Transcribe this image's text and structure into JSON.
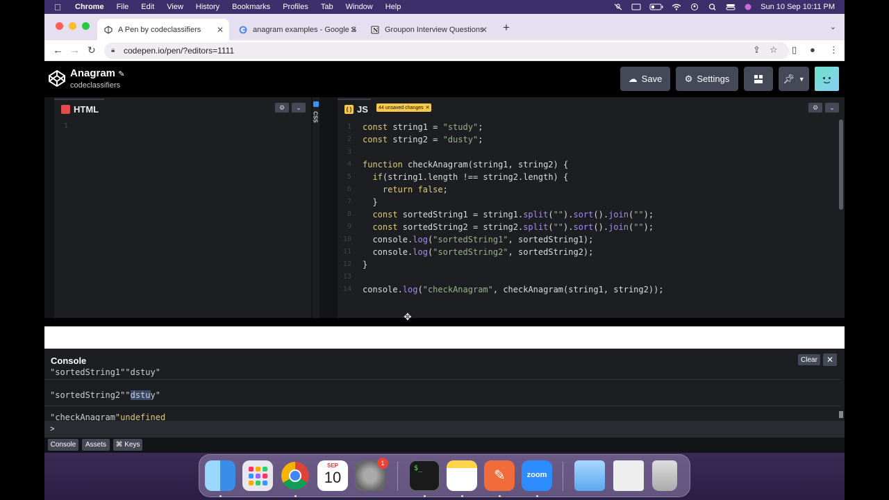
{
  "menubar": {
    "app": "Chrome",
    "items": [
      "File",
      "Edit",
      "View",
      "History",
      "Bookmarks",
      "Profiles",
      "Tab",
      "Window",
      "Help"
    ],
    "clock": "Sun 10 Sep  10:11 PM"
  },
  "browser": {
    "tabs": [
      {
        "title": "A Pen by codeclassifiers",
        "icon": "codepen-icon",
        "active": true
      },
      {
        "title": "anagram examples - Google S",
        "icon": "google-icon",
        "active": false
      },
      {
        "title": "Groupon Interview Questions",
        "icon": "notion-icon",
        "active": false
      }
    ],
    "url": "codepen.io/pen/?editors=1111"
  },
  "pen": {
    "title": "Anagram",
    "user": "codeclassifiers",
    "save_label": "Save",
    "settings_label": "Settings"
  },
  "html_pane": {
    "label": "HTML",
    "line_numbers": [
      "1"
    ]
  },
  "css_pane": {
    "label": "CSS"
  },
  "js_pane": {
    "label": "JS",
    "unsaved_badge": "44 unsaved changes",
    "lines": [
      {
        "n": "1",
        "text": "const string1 = \"study\";"
      },
      {
        "n": "2",
        "text": "const string2 = \"dusty\";"
      },
      {
        "n": "3",
        "text": ""
      },
      {
        "n": "4",
        "text": "function checkAnagram(string1, string2) {"
      },
      {
        "n": "5",
        "text": "  if(string1.length !== string2.length) {"
      },
      {
        "n": "6",
        "text": "    return false;"
      },
      {
        "n": "7",
        "text": "  }"
      },
      {
        "n": "8",
        "text": "  const sortedString1 = string1.split(\"\").sort().join(\"\");"
      },
      {
        "n": "9",
        "text": "  const sortedString2 = string2.split(\"\").sort().join(\"\");"
      },
      {
        "n": "10",
        "text": "  console.log(\"sortedString1\", sortedString1);"
      },
      {
        "n": "11",
        "text": "  console.log(\"sortedString2\", sortedString2);"
      },
      {
        "n": "12",
        "text": "}"
      },
      {
        "n": "13",
        "text": ""
      },
      {
        "n": "14",
        "text": "console.log(\"checkAnagram\", checkAnagram(string1, string2));"
      }
    ]
  },
  "console": {
    "title": "Console",
    "clear_label": "Clear",
    "rows": [
      {
        "key": "\"sortedString1\"",
        "pre": " \"",
        "hl": "",
        "val": "dstuy\""
      },
      {
        "key": "\"sortedString2\"",
        "pre": " \"",
        "hl": "dstu",
        "val": "y\""
      },
      {
        "key": "\"checkAnagram\"",
        "pre": " ",
        "hl": "",
        "val": "undefined"
      }
    ],
    "prompt": ">"
  },
  "bottom_buttons": [
    "Console",
    "Assets",
    "⌘ Keys"
  ],
  "dock": {
    "calendar_month": "SEP",
    "calendar_day": "10",
    "settings_badge": "1",
    "zoom_label": "zoom"
  }
}
